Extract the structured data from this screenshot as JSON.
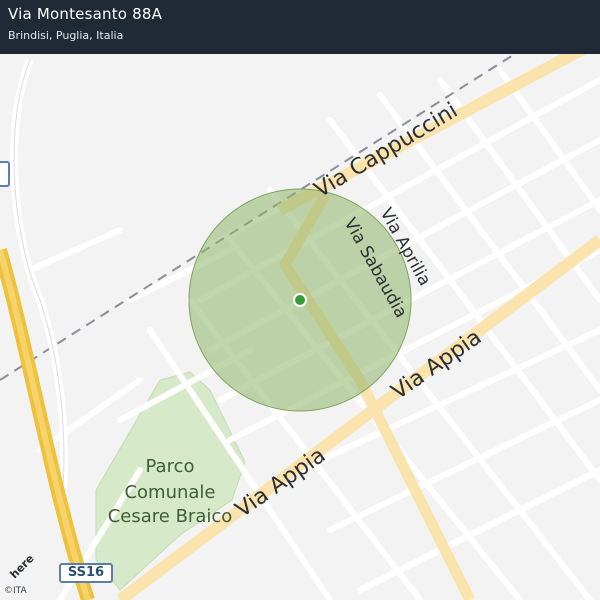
{
  "header": {
    "title": "Via Montesanto 88A",
    "subtitle": "Brindisi, Puglia, Italia"
  },
  "map": {
    "streets": {
      "cappuccini": "Via  Cappuccini",
      "aprilia": "Via  Aprilia",
      "sabaudia": "Via  Sabaudia",
      "appia_upper": "Via  Appia",
      "appia_lower": "Via  Appia"
    },
    "park": {
      "line1": "Parco",
      "line2": "Comunale",
      "line3": "Cesare Braico"
    },
    "road_shield": "SS16",
    "attribution": {
      "logo": "here",
      "copyright": "©ITA"
    },
    "colors": {
      "background": "#f3f3f3",
      "header": "#1f2a36",
      "major_road": "#fbe3ad",
      "highway": "#eec23c",
      "park": "#d6e9c9",
      "radius_circle": "#8fb46a",
      "location_dot": "#3a9b3a"
    },
    "icons": {
      "location": "location-dot-icon",
      "shield": "road-shield-icon"
    }
  }
}
